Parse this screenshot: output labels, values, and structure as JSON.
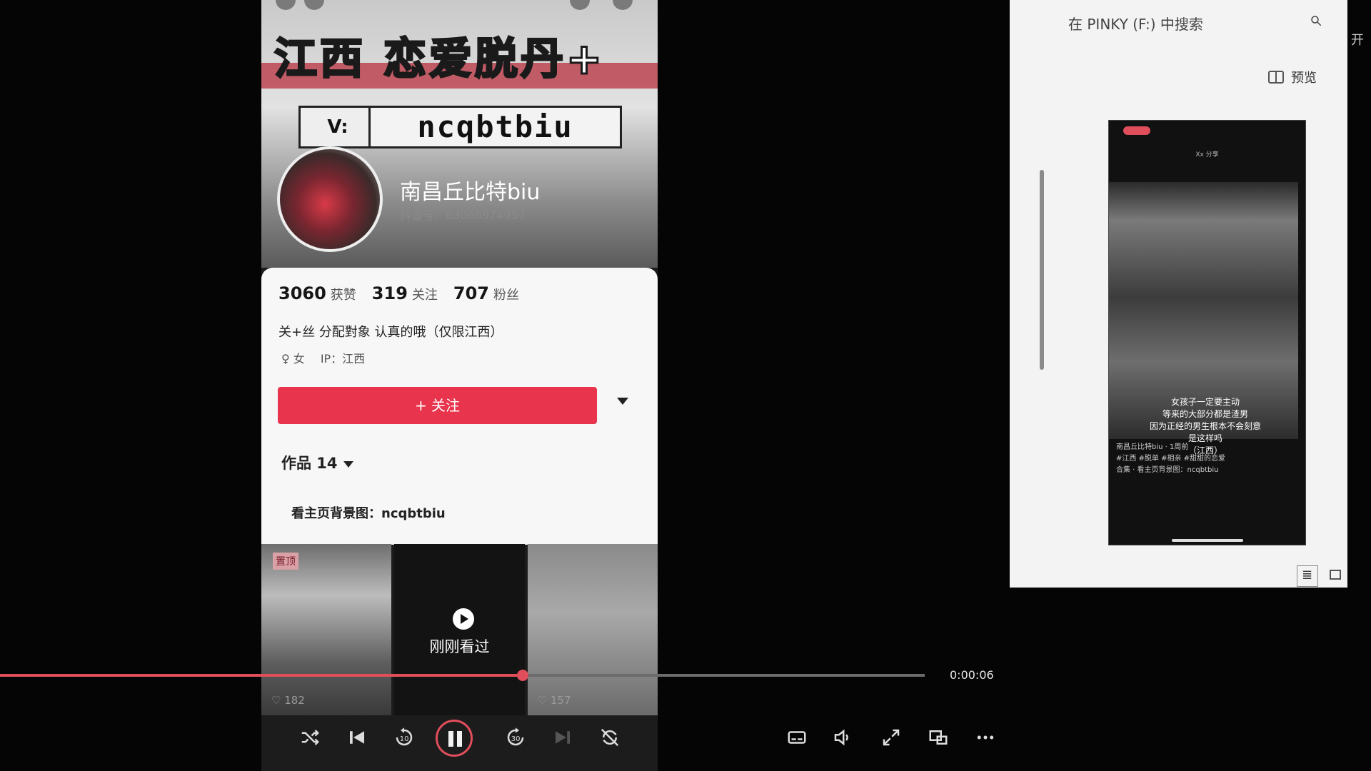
{
  "video": {
    "banner_title": "江西 恋爱脱丹+",
    "wechat_tag": "V:",
    "wechat_id": "ncqbtbiu",
    "nickname": "南昌丘比特biu",
    "douyin_id": "抖音号：63066974957",
    "stats": [
      {
        "num": "3060",
        "label": "获赞"
      },
      {
        "num": "319",
        "label": "关注"
      },
      {
        "num": "707",
        "label": "粉丝"
      }
    ],
    "bio": "关+丝 分配對象 认真的哦（仅限江西）",
    "gender": "♀ 女",
    "ip": "IP：江西",
    "follow_label": "+ 关注",
    "works_label": "作品 14",
    "bg_link": "看主页背景图：ncqbtbiu",
    "thumbs": [
      {
        "badge": "置顶",
        "likes": "♡ 182"
      },
      {
        "overlay": "刚刚看过",
        "likes": ""
      },
      {
        "likes": "♡ 157"
      }
    ]
  },
  "player": {
    "progress_fraction": 0.565,
    "time": "0:00:06",
    "controls": [
      "shuffle-icon",
      "previous-icon",
      "rewind-10-icon",
      "pause-icon",
      "forward-30-icon",
      "next-icon",
      "repeat-off-icon",
      "subtitles-icon",
      "volume-icon",
      "fullscreen-icon",
      "mini-player-icon",
      "more-icon"
    ]
  },
  "explorer": {
    "search_placeholder": "在 PINKY (F:) 中搜索",
    "open_label": "开",
    "preview_label": "预览",
    "preview": {
      "header": "Xx 分享",
      "caption": "女孩子一定要主动 \n 等来的大部分都是渣男 \n 因为正经的男生根本不会刻意 \n 是这样吗 \n（江西）",
      "footer_line1": "南昌丘比特biu · 1周前",
      "footer_line2": "#江西 #脱单 #相亲 #甜甜的恋爱",
      "footer_line3": "合集 · 看主页背景图：ncqbtbiu"
    }
  },
  "colors": {
    "accent": "#e8344d",
    "progress": "#e14e5b",
    "explorer_bg": "#f3f3f3"
  }
}
